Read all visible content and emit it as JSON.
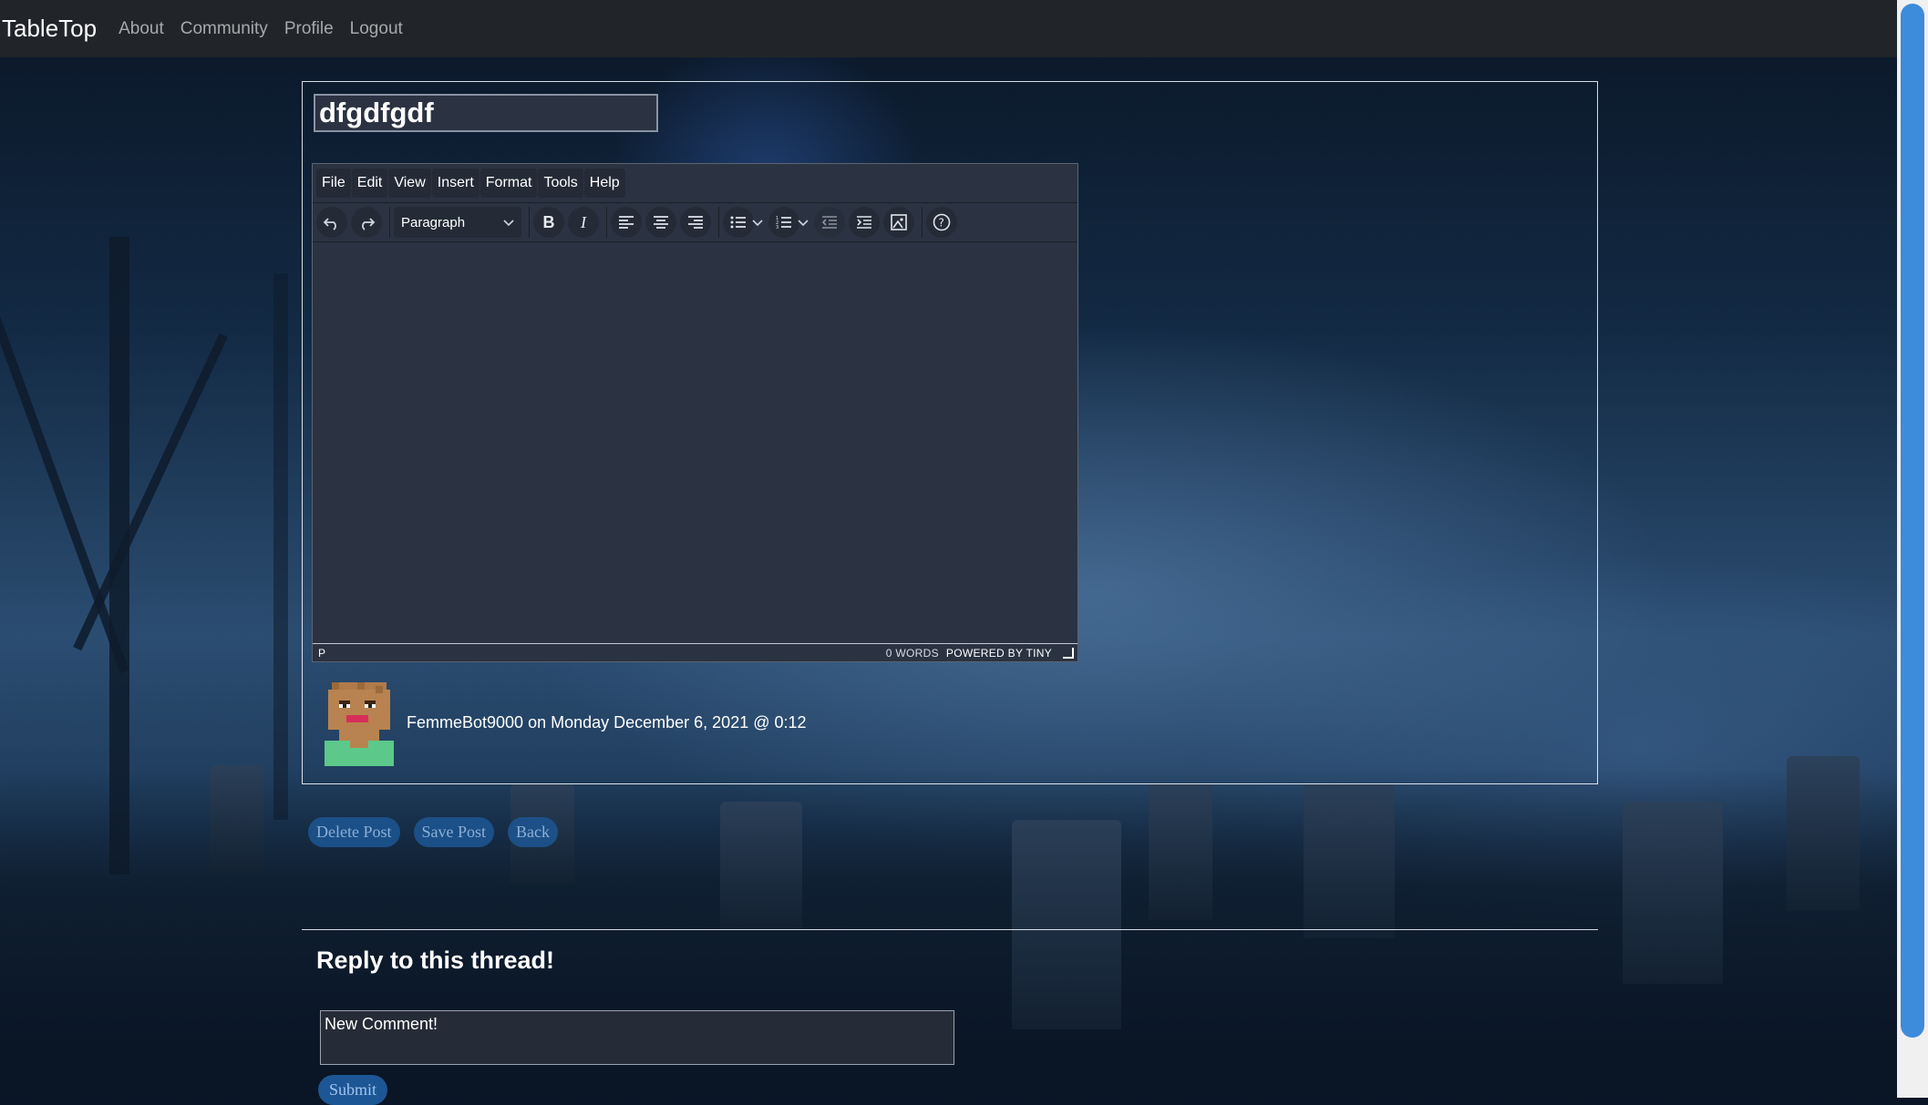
{
  "navbar": {
    "brand": "TableTop",
    "links": [
      "About",
      "Community",
      "Profile",
      "Logout"
    ]
  },
  "post": {
    "title_value": "dfgdfgdf",
    "author_line": "FemmeBot9000 on Monday December 6, 2021 @ 0:12"
  },
  "editor": {
    "menu": [
      "File",
      "Edit",
      "View",
      "Insert",
      "Format",
      "Tools",
      "Help"
    ],
    "block_format": "Paragraph",
    "status_path": "P",
    "word_count": "0 WORDS",
    "powered_by": "POWERED BY TINY"
  },
  "actions": {
    "delete": "Delete Post",
    "save": "Save Post",
    "back": "Back"
  },
  "reply": {
    "heading": "Reply to this thread!",
    "comment_value": "New Comment!",
    "submit": "Submit"
  },
  "colors": {
    "navbar": "#212529",
    "editor_bg": "#2b3342",
    "button_bg": "#1d5694",
    "scroll_thumb": "#3d8bdb"
  }
}
